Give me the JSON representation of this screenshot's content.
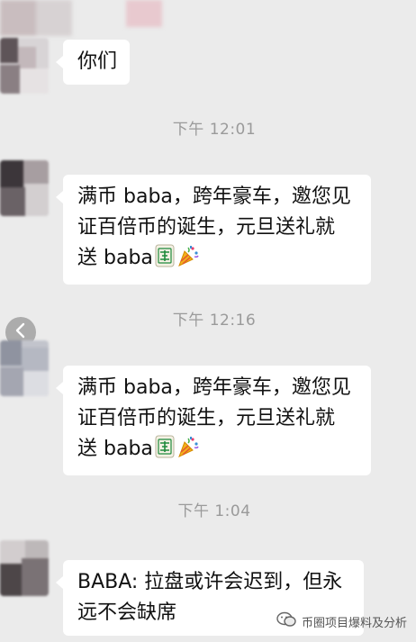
{
  "messages": [
    {
      "text": "你们"
    },
    {
      "text": "满币baba，跨年豪车，邀您见证百倍币的诞生，元旦送礼就送baba"
    },
    {
      "text": "满币baba，跨年豪车，邀您见证百倍币的诞生，元旦送礼就送baba"
    },
    {
      "text": "BABA: 拉盘或许会迟到，但永远不会缺席"
    }
  ],
  "msg2": {
    "line1": "满币 baba，跨年豪车，邀您见",
    "line2": "证百倍币的诞生，元旦送礼就",
    "line3": "送 baba"
  },
  "msg3": {
    "line1": "满币 baba，跨年豪车，邀您见",
    "line2": "证百倍币的诞生，元旦送礼就",
    "line3": "送 baba"
  },
  "msg4": {
    "line1": "BABA: 拉盘或许会迟到，但永",
    "line2": "远不会缺席"
  },
  "msg1": {
    "text": "你们"
  },
  "timestamps": [
    "下午 12:01",
    "下午 12:16",
    "下午 1:04"
  ],
  "watermark": {
    "text": "币圈项目爆料及分析"
  },
  "icons": {
    "back": "chevron-left-icon",
    "mahjong": "mahjong-fa-tile-icon",
    "party": "party-popper-icon",
    "watermark": "wechat-official-account-icon"
  },
  "colors": {
    "background": "#ebebeb",
    "bubble": "#ffffff",
    "timestamp": "#9a9a9a",
    "mahjong_green": "#1e8a3c"
  }
}
